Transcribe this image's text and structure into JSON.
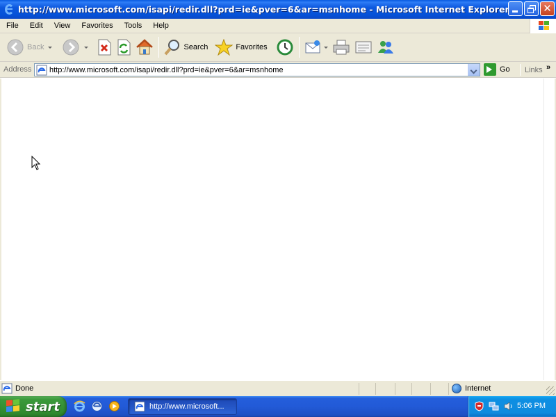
{
  "window": {
    "title": "http://www.microsoft.com/isapi/redir.dll?prd=ie&pver=6&ar=msnhome - Microsoft Internet Explorer"
  },
  "menu": {
    "items": [
      "File",
      "Edit",
      "View",
      "Favorites",
      "Tools",
      "Help"
    ]
  },
  "toolbar": {
    "back_label": "Back",
    "search_label": "Search",
    "favorites_label": "Favorites"
  },
  "address_bar": {
    "label": "Address",
    "url": "http://www.microsoft.com/isapi/redir.dll?prd=ie&pver=6&ar=msnhome",
    "go_label": "Go",
    "links_label": "Links",
    "chevron": "»"
  },
  "status_bar": {
    "status": "Done",
    "zone": "Internet"
  },
  "taskbar": {
    "start_label": "start",
    "task_item": "http://www.microsoft...",
    "clock": "5:06 PM"
  },
  "colors": {
    "titlebar_blue": "#0552d8",
    "chrome": "#ece9d8",
    "start_green": "#3c9a3c",
    "tray_blue": "#0f8bde"
  }
}
